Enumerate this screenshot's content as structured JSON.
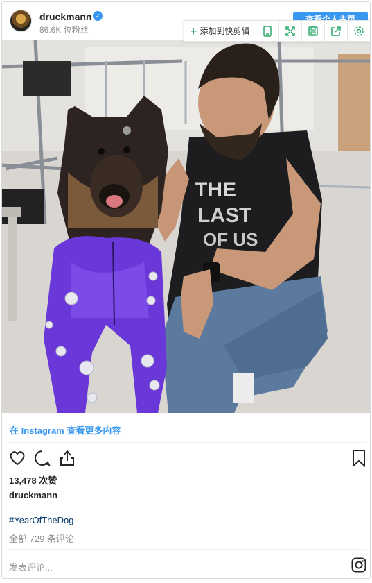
{
  "header": {
    "username": "druckmann",
    "verified_mark": "✓",
    "followers": "86.6K 位粉丝",
    "view_profile_label": "查看个人主页"
  },
  "toolbar": {
    "add_label": "添加到快剪辑",
    "icons": [
      "phone-icon",
      "expand-icon",
      "save-icon",
      "share-icon",
      "settings-icon"
    ]
  },
  "post": {
    "more_link": "在 Instagram 查看更多内容",
    "likes": "13,478 次赞",
    "caption_user": "druckmann",
    "hashtag": "#YearOfTheDog",
    "comments": "全部 729 条评论",
    "comment_placeholder": "发表评论..."
  },
  "colors": {
    "accent": "#3897f0",
    "toolbar_green": "#2aa96b"
  }
}
